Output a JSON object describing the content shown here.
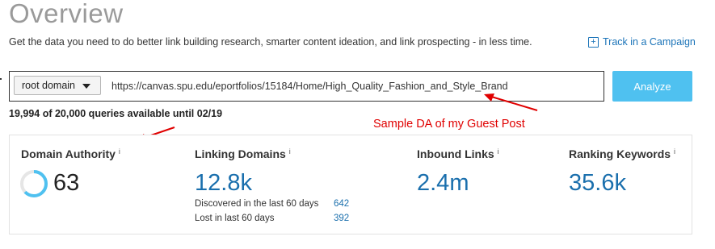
{
  "header": {
    "title": "Overview",
    "subtitle": "Get the data you need to do better link building research, smarter content ideation, and link prospecting - in less time.",
    "campaign_link": "Track in a Campaign"
  },
  "search": {
    "scope_selected": "root domain",
    "url_value": "https://canvas.spu.edu/eportfolios/15184/Home/High_Quality_Fashion_and_Style_Brand",
    "analyze_label": "Analyze"
  },
  "quota": "19,994 of 20,000 queries available until 02/19",
  "annotation": "Sample DA of my Guest Post",
  "metrics": {
    "domain_authority": {
      "label": "Domain Authority",
      "value": "63",
      "score": 63
    },
    "linking_domains": {
      "label": "Linking Domains",
      "value": "12.8k",
      "discovered_label": "Discovered in the last 60 days",
      "discovered_value": "642",
      "lost_label": "Lost in last 60 days",
      "lost_value": "392"
    },
    "inbound_links": {
      "label": "Inbound Links",
      "value": "2.4m"
    },
    "ranking_keywords": {
      "label": "Ranking Keywords",
      "value": "35.6k"
    }
  },
  "colors": {
    "accent": "#1a6fad",
    "analyze_button": "#4fc1f0",
    "annotation": "#e00000",
    "ring": "#4fc1f0"
  },
  "icons": {
    "campaign": "plus-square-icon",
    "info": "info-icon",
    "dropdown": "chevron-down-icon"
  }
}
